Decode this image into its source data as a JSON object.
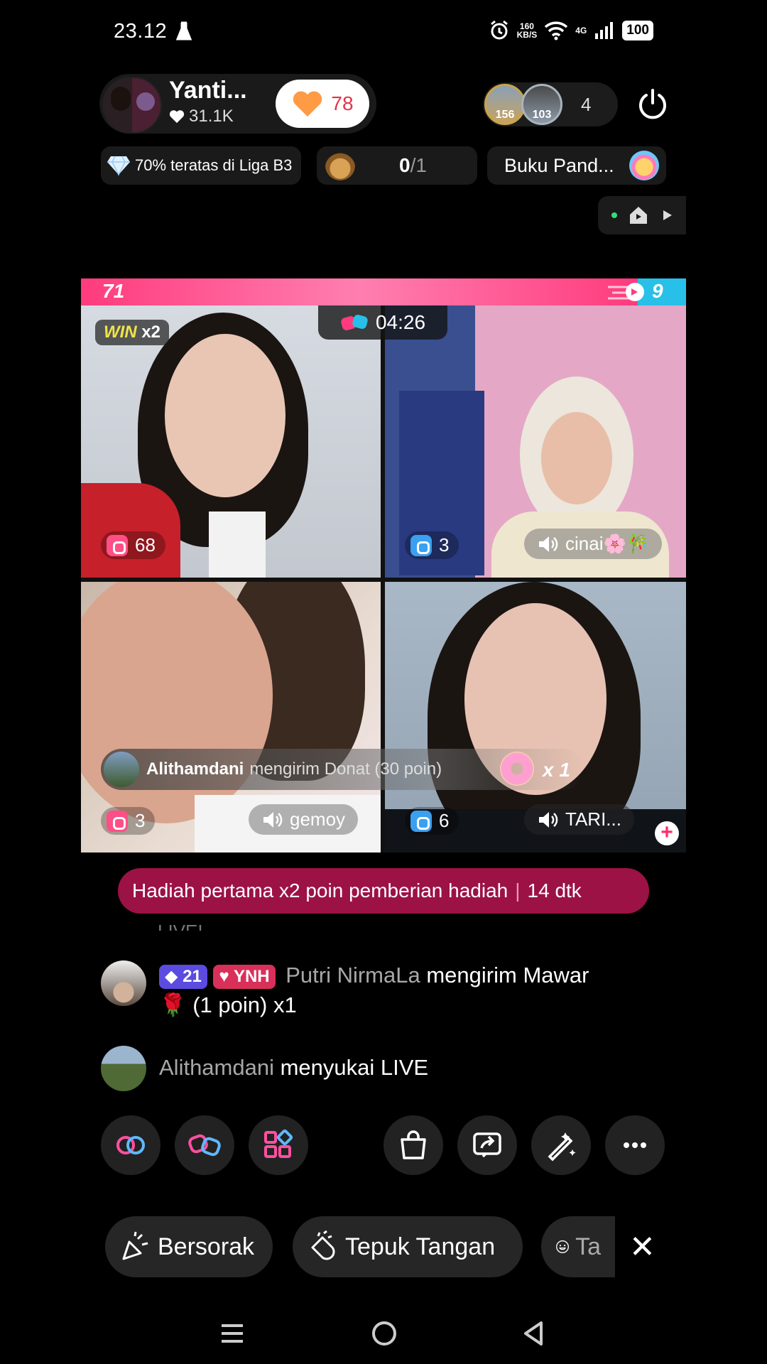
{
  "status_bar": {
    "time": "23.12",
    "net_speed_top": "160",
    "net_speed_bottom": "KB/S",
    "network": "4G",
    "battery": "100"
  },
  "host": {
    "name": "Yanti...",
    "likes": "31.1K",
    "follow_count": "78"
  },
  "viewers": {
    "badge1": "156",
    "badge2": "103",
    "count": "4"
  },
  "chips": {
    "league": "70% teratas di Liga B3",
    "goal_current": "0",
    "goal_total": "/1",
    "guide": "Buku Pand..."
  },
  "battle": {
    "score_left": "71",
    "score_right": "9",
    "timer": "04:26",
    "win_label": "WIN",
    "win_mult": "x2",
    "cells": [
      {
        "gifts": "68"
      },
      {
        "gifts": "3",
        "name": "cinai🌸🎋"
      },
      {
        "gifts": "3",
        "name": "gemoy"
      },
      {
        "gifts": "6",
        "name": "TARI..."
      }
    ]
  },
  "gift_banner": {
    "user": "Alithamdani",
    "text": "mengirim Donat (30 poin)",
    "mult": "x 1"
  },
  "hint": {
    "text": "Hadiah pertama x2 poin pemberian hadiah",
    "timer": "14 dtk"
  },
  "comments": {
    "faded": "LIVE!",
    "c1_level": "21",
    "c1_fan": "YNH",
    "c1_user": "Putri NirmaLa",
    "c1_text1": "mengirim Mawar",
    "c1_text2": "(1 poin) x1",
    "c2_user": "Alithamdani",
    "c2_text": "menyukai LIVE"
  },
  "reactions": {
    "r1": "Bersorak",
    "r2": "Tepuk Tangan",
    "r3": "Ta"
  },
  "colors": {
    "accent_pink": "#ff3b7d",
    "accent_blue": "#28c0e8",
    "hint_bg": "#9c1245"
  }
}
